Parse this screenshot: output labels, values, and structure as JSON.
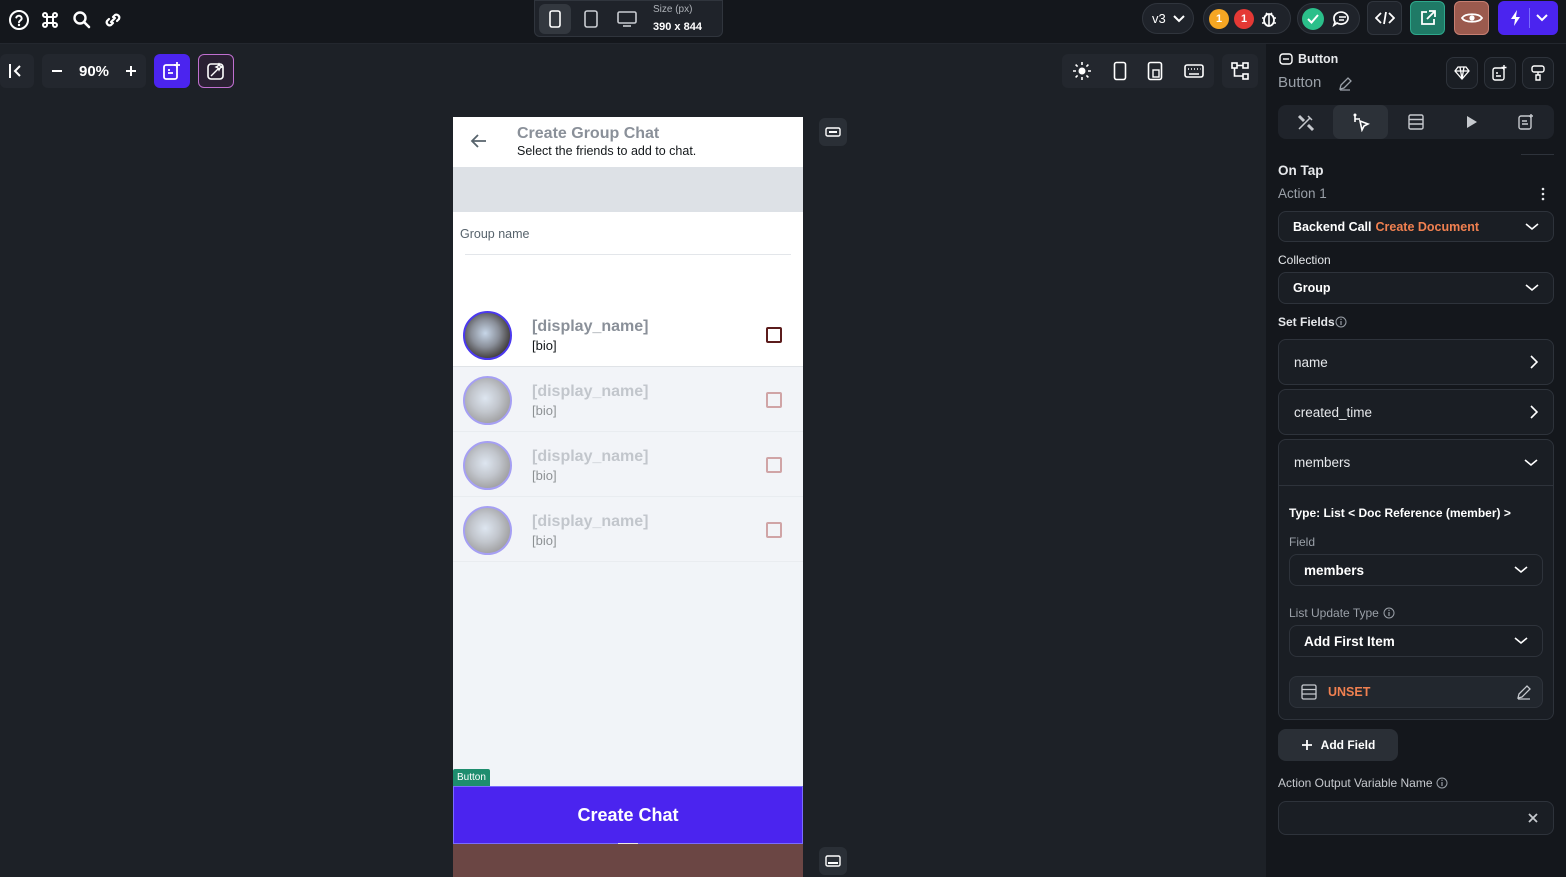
{
  "topbar": {
    "version": "v3",
    "warning_count": "1",
    "error_count": "1",
    "size_label": "Size (px)",
    "size_value": "390 x 844"
  },
  "canvas": {
    "zoom": "90%"
  },
  "phone": {
    "title": "Create Group Chat",
    "subtitle": "Select the friends to add to chat.",
    "group_name_label": "Group name",
    "rows": [
      {
        "name": "[display_name]",
        "bio": "[bio]"
      },
      {
        "name": "[display_name]",
        "bio": "[bio]"
      },
      {
        "name": "[display_name]",
        "bio": "[bio]"
      },
      {
        "name": "[display_name]",
        "bio": "[bio]"
      }
    ],
    "button_tag": "Button",
    "button_label": "Create Chat"
  },
  "panel": {
    "widget_type": "Button",
    "widget_name": "Button",
    "on_tap": "On Tap",
    "action_label": "Action 1",
    "backend_call": "Backend Call",
    "backend_action": "Create Document",
    "collection_label": "Collection",
    "collection_value": "Group",
    "set_fields_label": "Set Fields",
    "fields": [
      "name",
      "created_time",
      "members"
    ],
    "type_text": "Type: List < Doc Reference (member) >",
    "field_label": "Field",
    "field_value": "members",
    "list_update_label": "List Update Type",
    "list_update_value": "Add First Item",
    "unset_label": "UNSET",
    "add_field": "Add Field",
    "output_var_label": "Action Output Variable Name",
    "output_var_value": ""
  },
  "colors": {
    "accent": "#4b24ef",
    "backend_action": "#f08050",
    "unset": "#f08050",
    "warning": "#f5a623",
    "error": "#e53935",
    "success": "#2bbf8a"
  }
}
